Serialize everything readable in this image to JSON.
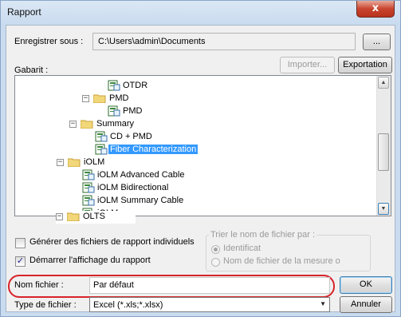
{
  "window": {
    "title": "Rapport",
    "close_glyph": "x"
  },
  "save": {
    "label": "Enregistrer sous :",
    "path": "C:\\Users\\admin\\Documents",
    "browse_label": "..."
  },
  "template": {
    "label": "Gabarit :",
    "import_label": "Importer...",
    "export_label": "Exportation",
    "tree": [
      {
        "label": "OTDR",
        "icon": "report-icon",
        "type": "doc"
      },
      {
        "label": "PMD",
        "icon": "folder-icon",
        "type": "folder",
        "expanded": true
      },
      {
        "label": "PMD",
        "icon": "report-icon",
        "type": "doc"
      },
      {
        "label": "Summary",
        "icon": "folder-icon",
        "type": "folder",
        "expanded": true
      },
      {
        "label": "CD + PMD",
        "icon": "report-icon",
        "type": "doc"
      },
      {
        "label": "Fiber Characterization",
        "icon": "report-icon",
        "type": "doc",
        "selected": true
      },
      {
        "label": "iOLM",
        "icon": "folder-icon",
        "type": "folder",
        "expanded": true
      },
      {
        "label": "iOLM Advanced Cable",
        "icon": "report-icon",
        "type": "doc"
      },
      {
        "label": "iOLM Bidirectional",
        "icon": "report-icon",
        "type": "doc"
      },
      {
        "label": "iOLM Summary Cable",
        "icon": "report-icon",
        "type": "doc"
      },
      {
        "label": "iOLM",
        "icon": "report-icon",
        "type": "doc"
      },
      {
        "label": "OLTS",
        "icon": "folder-icon",
        "type": "folder",
        "expanded": true
      }
    ]
  },
  "options": {
    "individual_files_label": "Générer des fichiers de rapport individuels",
    "individual_files_checked": false,
    "start_display_label": "Démarrer l'affichage du rapport",
    "start_display_checked": true,
    "sort_group_label": "Trier le nom de fichier par :",
    "sort_identifier_label": "Identificat",
    "sort_measure_label": "Nom de fichier de la mesure o",
    "sort_selected": "identifier"
  },
  "filename": {
    "label": "Nom fichier :",
    "value": "Par défaut",
    "ok_label": "OK"
  },
  "filetype": {
    "label": "Type de fichier :",
    "value": "Excel (*.xls;*.xlsx)",
    "cancel_label": "Annuler"
  },
  "colors": {
    "selection": "#3399ff",
    "highlight_ring": "#d8232a"
  }
}
